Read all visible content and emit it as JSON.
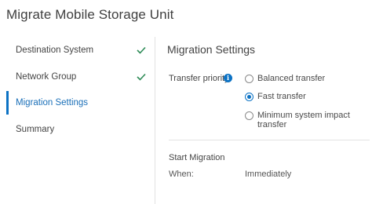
{
  "dialog": {
    "title": "Migrate Mobile Storage Unit"
  },
  "colors": {
    "accent": "#0c72c4",
    "check": "#2e8b57",
    "active_text": "#1a6fb8",
    "divider": "#e3e3e3"
  },
  "steps": [
    {
      "label": "Destination System",
      "completed": true,
      "active": false,
      "icon": "check-icon"
    },
    {
      "label": "Network Group",
      "completed": true,
      "active": false,
      "icon": "check-icon"
    },
    {
      "label": "Migration Settings",
      "completed": false,
      "active": true
    },
    {
      "label": "Summary",
      "completed": false,
      "active": false
    }
  ],
  "settings": {
    "section_title": "Migration Settings",
    "transfer_priority_label": "Transfer priority:",
    "info_icon": "info-icon",
    "info_glyph": "i",
    "options": [
      {
        "label": "Balanced transfer",
        "selected": false
      },
      {
        "label": "Fast transfer",
        "selected": true
      },
      {
        "label": "Minimum system impact transfer",
        "selected": false
      }
    ]
  },
  "start_migration": {
    "title": "Start Migration",
    "when_label": "When:",
    "when_value": "Immediately"
  }
}
